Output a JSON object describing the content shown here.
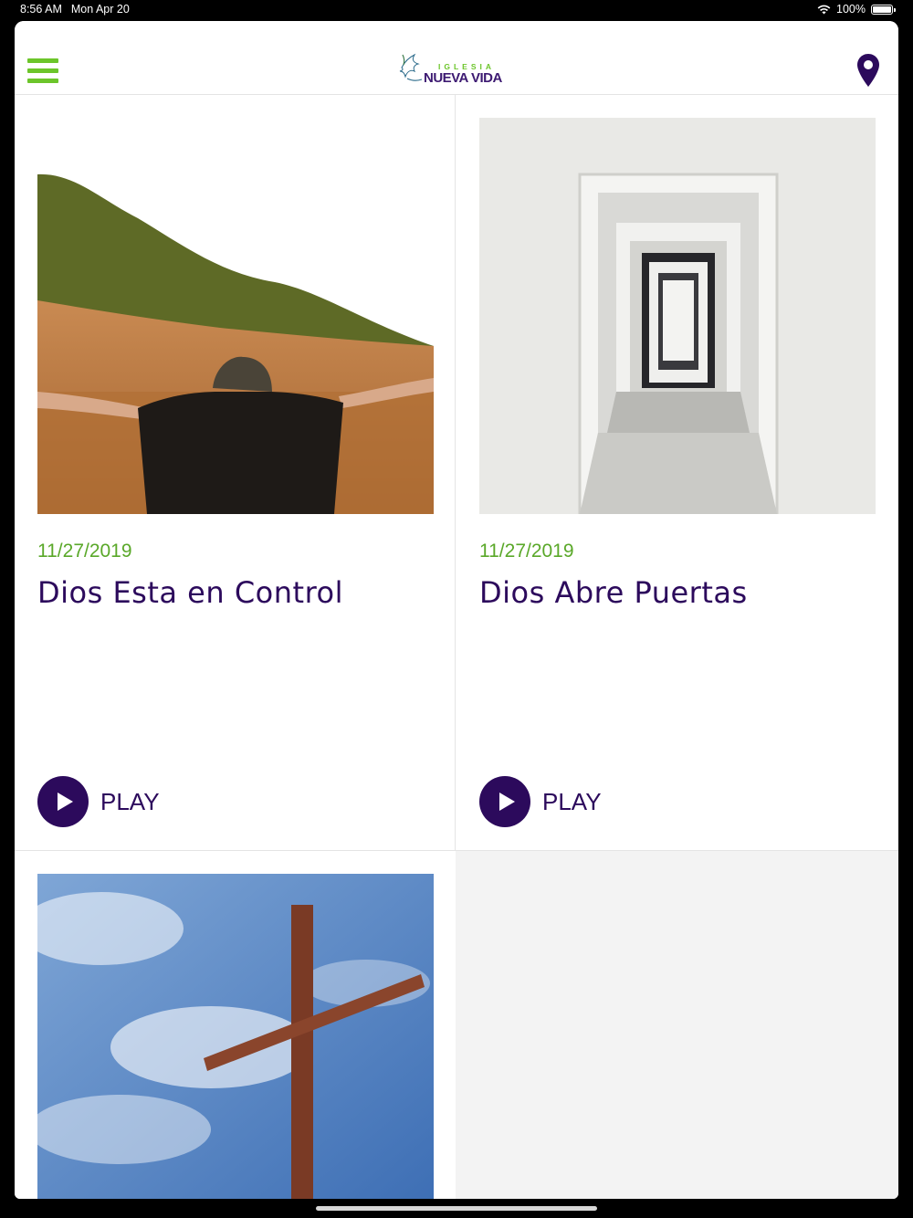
{
  "status_bar": {
    "time": "8:56 AM",
    "date": "Mon Apr 20",
    "battery": "100%"
  },
  "header": {
    "logo_small": "IGLESIA",
    "logo_large": "NUEVA VIDA"
  },
  "cards": [
    {
      "date": "11/27/2019",
      "title": "Dios Esta en Control",
      "play_label": "PLAY"
    },
    {
      "date": "11/27/2019",
      "title": "Dios Abre Puertas",
      "play_label": "PLAY"
    },
    {
      "date": "",
      "title": "",
      "play_label": ""
    }
  ],
  "colors": {
    "accent_green": "#6cc52a",
    "brand_purple": "#2c0a5c"
  }
}
